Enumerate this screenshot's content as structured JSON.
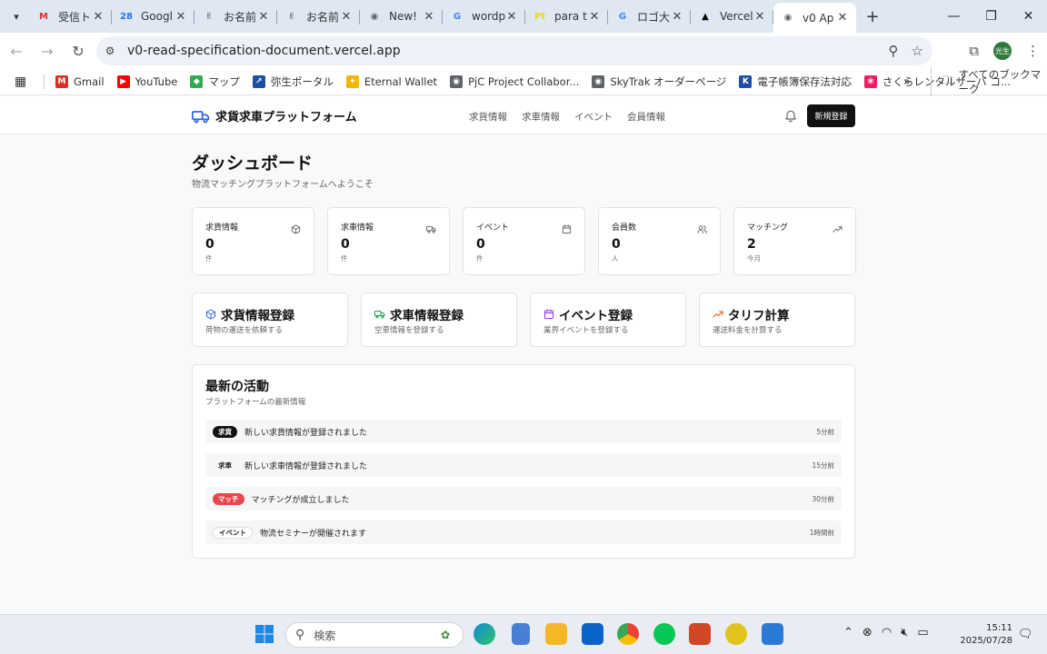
{
  "browser": {
    "tabs": [
      {
        "title": "受信ト",
        "favicon": "gmail",
        "color": "#d93025",
        "glyph": "M"
      },
      {
        "title": "Googl",
        "favicon": "calendar",
        "color": "#1a73e8",
        "glyph": "28"
      },
      {
        "title": "お名前",
        "favicon": "onamae",
        "color": "#333333",
        "glyph": "✌"
      },
      {
        "title": "お名前",
        "favicon": "onamae",
        "color": "#333333",
        "glyph": "✌"
      },
      {
        "title": "New!",
        "favicon": "globe",
        "color": "#5f6368",
        "glyph": "◉"
      },
      {
        "title": "wordp",
        "favicon": "google",
        "color": "#4285f4",
        "glyph": "G"
      },
      {
        "title": "para t",
        "favicon": "pt",
        "color": "#f4d21f",
        "glyph": "Pt"
      },
      {
        "title": "ロゴ大",
        "favicon": "google",
        "color": "#4285f4",
        "glyph": "G"
      },
      {
        "title": "Vercel",
        "favicon": "vercel",
        "color": "#000000",
        "glyph": "▲"
      },
      {
        "title": "v0 Ap",
        "favicon": "globe",
        "color": "#5f6368",
        "glyph": "◉",
        "active": true
      }
    ],
    "url": "v0-read-specification-document.vercel.app",
    "profile_label": "光生",
    "bookmarks": [
      {
        "label": "Gmail",
        "color": "#d93025",
        "glyph": "M"
      },
      {
        "label": "YouTube",
        "color": "#ff0000",
        "glyph": "▶"
      },
      {
        "label": "マップ",
        "color": "#34a853",
        "glyph": "◆"
      },
      {
        "label": "弥生ポータル",
        "color": "#1d4fa3",
        "glyph": "↗"
      },
      {
        "label": "Eternal Wallet",
        "color": "#f2b705",
        "glyph": "✦"
      },
      {
        "label": "PjC Project Collabor...",
        "color": "#5f6368",
        "glyph": "◉"
      },
      {
        "label": "SkyTrak オーダーページ",
        "color": "#5f6368",
        "glyph": "◉"
      },
      {
        "label": "電子帳簿保存法対応",
        "color": "#1d4fa3",
        "glyph": "K"
      },
      {
        "label": "さくらレンタルサーバ コ...",
        "color": "#e91e63",
        "glyph": "❀"
      }
    ],
    "all_bookmarks": "すべてのブックマーク"
  },
  "app": {
    "brand": "求貨求車プラットフォーム",
    "nav": [
      "求貨情報",
      "求車情報",
      "イベント",
      "会員情報"
    ],
    "signup_button": "新規登録",
    "page_title": "ダッシュボード",
    "page_subtitle": "物流マッチングプラットフォームへようこそ",
    "stats": [
      {
        "label": "求貨情報",
        "value": "0",
        "unit": "件",
        "icon": "box-icon"
      },
      {
        "label": "求車情報",
        "value": "0",
        "unit": "件",
        "icon": "truck-icon"
      },
      {
        "label": "イベント",
        "value": "0",
        "unit": "件",
        "icon": "calendar-icon"
      },
      {
        "label": "会員数",
        "value": "0",
        "unit": "人",
        "icon": "users-icon"
      },
      {
        "label": "マッチング",
        "value": "2",
        "unit": "今月",
        "icon": "trending-up-icon"
      }
    ],
    "actions": [
      {
        "title": "求貨情報登録",
        "desc": "荷物の運送を依頼する",
        "icon": "box-icon",
        "color": "#2563eb"
      },
      {
        "title": "求車情報登録",
        "desc": "空車情報を登録する",
        "icon": "truck-icon",
        "color": "#16a34a"
      },
      {
        "title": "イベント登録",
        "desc": "業界イベントを登録する",
        "icon": "calendar-icon",
        "color": "#9333ea"
      },
      {
        "title": "タリフ計算",
        "desc": "運送料金を計算する",
        "icon": "trending-up-icon",
        "color": "#ea580c"
      }
    ],
    "activity": {
      "title": "最新の活動",
      "subtitle": "プラットフォームの最新情報",
      "items": [
        {
          "badge": "求貨",
          "style": "dark",
          "message": "新しい求貨情報が登録されました",
          "time": "5分前"
        },
        {
          "badge": "求車",
          "style": "plain",
          "message": "新しい求車情報が登録されました",
          "time": "15分前"
        },
        {
          "badge": "マッチ",
          "style": "red",
          "message": "マッチングが成立しました",
          "time": "30分前"
        },
        {
          "badge": "イベント",
          "style": "outline",
          "message": "物流セミナーが開催されます",
          "time": "1時間前"
        }
      ]
    }
  },
  "taskbar": {
    "search_placeholder": "検索",
    "time": "15:11",
    "date": "2025/07/28"
  }
}
